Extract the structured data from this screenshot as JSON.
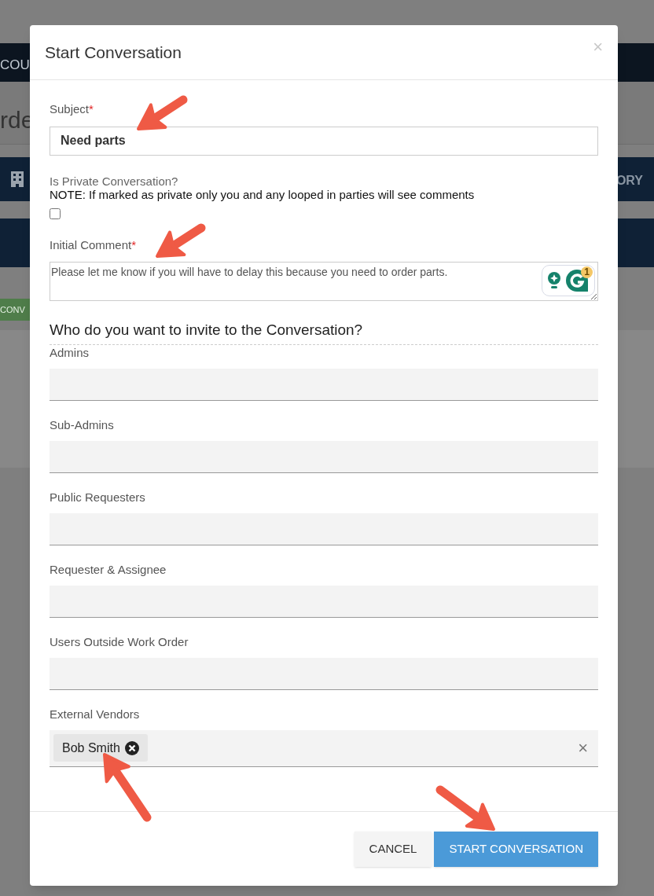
{
  "background": {
    "top_bar_text": "COU",
    "page_title": "rde",
    "tab_bar_text": "ORY",
    "badge": "CONV"
  },
  "dialog": {
    "title": "Start Conversation",
    "close": "×",
    "subject": {
      "label": "Subject",
      "required_mark": "*",
      "value": "Need parts"
    },
    "private": {
      "label": "Is Private Conversation?",
      "note": "NOTE: If marked as private only you and any looped in parties will see comments",
      "checked": false
    },
    "comment": {
      "label": "Initial Comment",
      "required_mark": "*",
      "value": "Please let me know if you will have to delay this because you need to order parts.",
      "assistant_badge": "1"
    },
    "invite_heading": "Who do you want to invite to the Conversation?",
    "invite_fields": [
      {
        "label": "Admins"
      },
      {
        "label": "Sub-Admins"
      },
      {
        "label": "Public Requesters"
      },
      {
        "label": "Requester & Assignee"
      },
      {
        "label": "Users Outside Work Order"
      },
      {
        "label": "External Vendors",
        "tags": [
          "Bob Smith"
        ],
        "clear": "×"
      }
    ],
    "buttons": [
      {
        "label": "CANCEL",
        "kind": "secondary"
      },
      {
        "label": "START CONVERSATION",
        "kind": "primary"
      }
    ]
  }
}
